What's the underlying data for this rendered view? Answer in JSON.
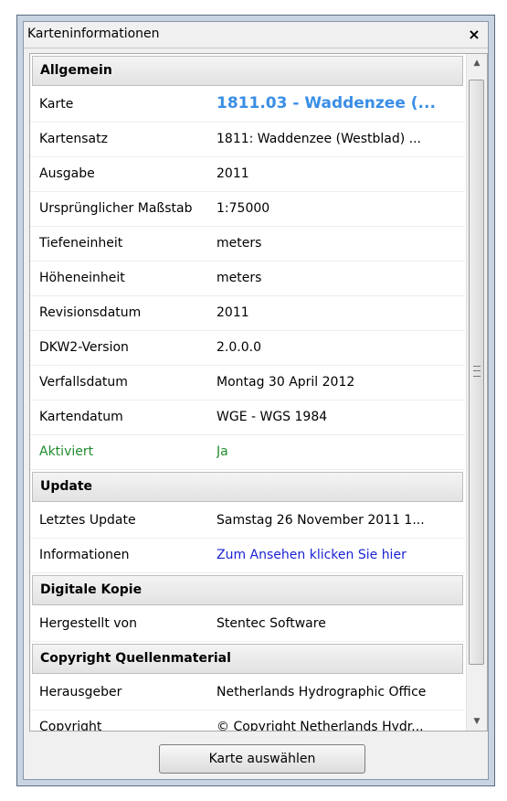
{
  "window": {
    "title": "Karteninformationen",
    "close_label": "×"
  },
  "sections": {
    "allgemein": {
      "header": "Allgemein",
      "rows": {
        "karte": {
          "label": "Karte",
          "value": "1811.03 - Waddenzee (..."
        },
        "kartensatz": {
          "label": "Kartensatz",
          "value": "1811: Waddenzee (Westblad) ..."
        },
        "ausgabe": {
          "label": "Ausgabe",
          "value": "2011"
        },
        "massstab": {
          "label": "Ursprünglicher Maßstab",
          "value": "1:75000"
        },
        "tiefeneinheit": {
          "label": "Tiefeneinheit",
          "value": "meters"
        },
        "hoeheneinheit": {
          "label": "Höheneinheit",
          "value": "meters"
        },
        "revisionsdatum": {
          "label": "Revisionsdatum",
          "value": "2011"
        },
        "dkw2": {
          "label": "DKW2-Version",
          "value": "2.0.0.0"
        },
        "verfallsdatum": {
          "label": "Verfallsdatum",
          "value": "Montag 30 April 2012"
        },
        "kartendatum": {
          "label": "Kartendatum",
          "value": "WGE - WGS 1984"
        },
        "aktiviert": {
          "label": "Aktiviert",
          "value": "Ja"
        }
      }
    },
    "update": {
      "header": "Update",
      "rows": {
        "letztes_update": {
          "label": "Letztes Update",
          "value": "Samstag 26 November 2011 1..."
        },
        "informationen": {
          "label": "Informationen",
          "value": "Zum Ansehen klicken Sie hier"
        }
      }
    },
    "digitale_kopie": {
      "header": "Digitale Kopie",
      "rows": {
        "hergestellt": {
          "label": "Hergestellt von",
          "value": "Stentec Software"
        }
      }
    },
    "copyright": {
      "header": "Copyright Quellenmaterial",
      "rows": {
        "herausgeber": {
          "label": "Herausgeber",
          "value": "Netherlands Hydrographic Office"
        },
        "copyright": {
          "label": "Copyright",
          "value": "© Copyright Netherlands Hydr..."
        }
      }
    }
  },
  "scrollbar": {
    "up_glyph": "▲",
    "down_glyph": "▼"
  },
  "footer": {
    "select_button_label": "Karte auswählen"
  },
  "colors": {
    "chart_name": "#3a8ee6",
    "link": "#1a23d6",
    "activated": "#1f8c2e"
  }
}
